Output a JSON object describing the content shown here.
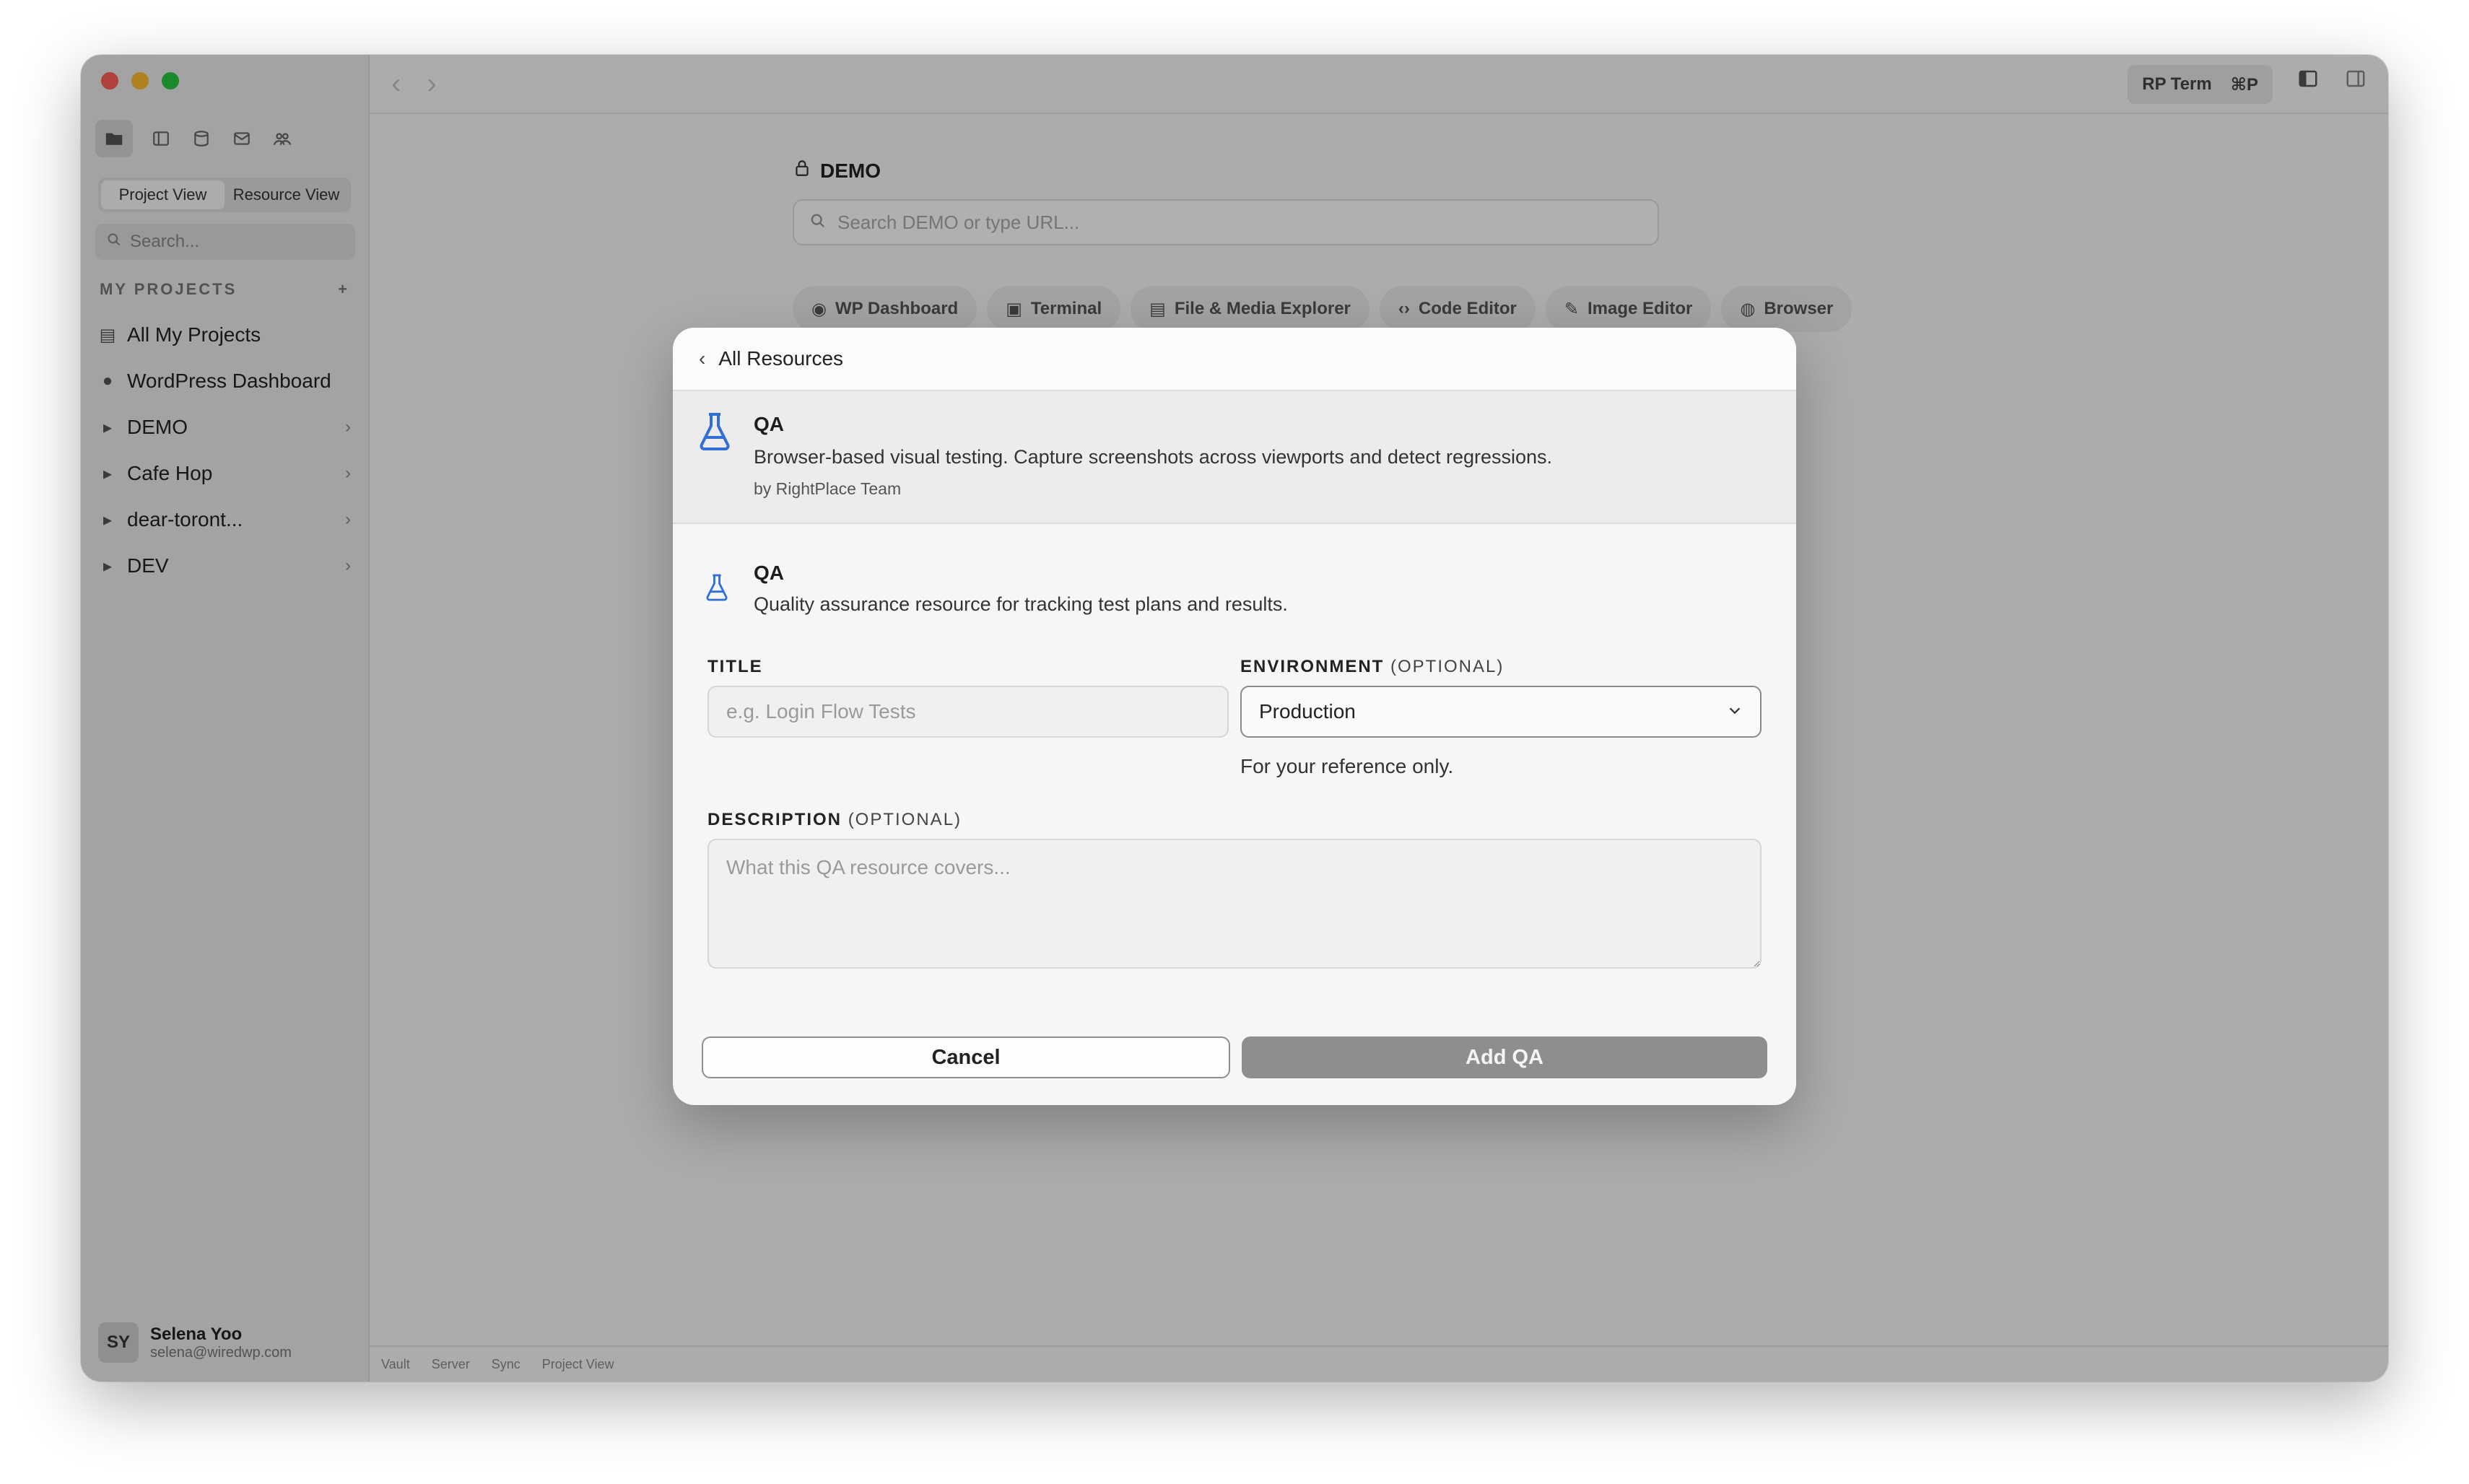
{
  "sidebar": {
    "view_toggle": [
      "Project View",
      "Resource View"
    ],
    "search_placeholder": "Search...",
    "projects_header": "MY PROJECTS",
    "add_symbol": "+",
    "items": [
      {
        "label": "All My Projects"
      },
      {
        "label": "WordPress Dashboard"
      },
      {
        "label": "DEMO"
      },
      {
        "label": "Cafe Hop"
      },
      {
        "label": "dear-toront..."
      },
      {
        "label": "DEV"
      }
    ],
    "user": {
      "initials": "SY",
      "name": "Selena Yoo",
      "email": "selena@wiredwp.com"
    }
  },
  "topbar": {
    "rp_term": "RP Term",
    "rp_term_shortcut": "⌘P"
  },
  "main": {
    "project_title": "DEMO",
    "search_placeholder": "Search DEMO or type URL...",
    "chips": [
      "WP Dashboard",
      "Terminal",
      "File & Media Explorer",
      "Code Editor",
      "Image Editor",
      "Browser"
    ]
  },
  "statusbar": [
    "Vault",
    "Server",
    "Sync",
    "Project View"
  ],
  "modal": {
    "back_label": "All Resources",
    "header": {
      "name": "QA",
      "description": "Browser-based visual testing. Capture screenshots across viewports and detect regressions.",
      "author": "by RightPlace Team"
    },
    "section": {
      "name": "QA",
      "description": "Quality assurance resource for tracking test plans and results."
    },
    "title_label": "TITLE",
    "title_placeholder": "e.g. Login Flow Tests",
    "env_label": "ENVIRONMENT",
    "env_optional": "(OPTIONAL)",
    "env_value": "Production",
    "env_hint": "For your reference only.",
    "desc_label": "DESCRIPTION",
    "desc_optional": "(OPTIONAL)",
    "desc_placeholder": "What this QA resource covers...",
    "cancel_label": "Cancel",
    "submit_label": "Add QA"
  },
  "colors": {
    "accent_icon": "#2f6fd6",
    "submit_bg": "#8e8e8e"
  }
}
